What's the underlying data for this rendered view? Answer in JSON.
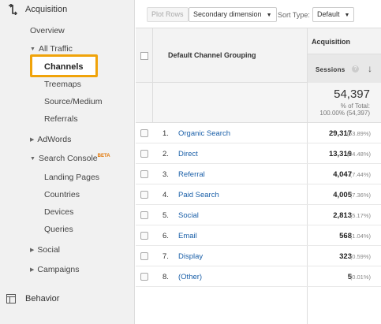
{
  "sidebar": {
    "acquisition": "Acquisition",
    "overview": "Overview",
    "all_traffic": "All Traffic",
    "channels": "Channels",
    "treemaps": "Treemaps",
    "source_medium": "Source/Medium",
    "referrals": "Referrals",
    "adwords": "AdWords",
    "search_console": "Search Console",
    "beta": "BETA",
    "landing_pages": "Landing Pages",
    "countries": "Countries",
    "devices": "Devices",
    "queries": "Queries",
    "social": "Social",
    "campaigns": "Campaigns",
    "behavior": "Behavior"
  },
  "toolbar": {
    "plot_rows": "Plot Rows",
    "secondary_dimension": "Secondary dimension",
    "sort_type_label": "Sort Type:",
    "sort_type_value": "Default"
  },
  "table": {
    "dimension_header": "Default Channel Grouping",
    "group_header": "Acquisition",
    "metric_header": "Sessions",
    "help_icon": "?",
    "sort_arrow": "↓",
    "total": {
      "value": "54,397",
      "label": "% of Total:",
      "pct": "100.00% (54,397)"
    },
    "rows": [
      {
        "num": "1.",
        "name": "Organic Search",
        "value": "29,317",
        "pct": "(53.89%)"
      },
      {
        "num": "2.",
        "name": "Direct",
        "value": "13,319",
        "pct": "(24.48%)"
      },
      {
        "num": "3.",
        "name": "Referral",
        "value": "4,047",
        "pct": "(7.44%)"
      },
      {
        "num": "4.",
        "name": "Paid Search",
        "value": "4,005",
        "pct": "(7.36%)"
      },
      {
        "num": "5.",
        "name": "Social",
        "value": "2,813",
        "pct": "(5.17%)"
      },
      {
        "num": "6.",
        "name": "Email",
        "value": "568",
        "pct": "(1.04%)"
      },
      {
        "num": "7.",
        "name": "Display",
        "value": "323",
        "pct": "(0.59%)"
      },
      {
        "num": "8.",
        "name": "(Other)",
        "value": "5",
        "pct": "(0.01%)"
      }
    ]
  },
  "icons": {
    "acquisition": "acquisition-icon",
    "behavior": "behavior-icon"
  },
  "colors": {
    "highlight": "#f0a30a",
    "link": "#1a5fa8",
    "beta": "#e37400"
  }
}
